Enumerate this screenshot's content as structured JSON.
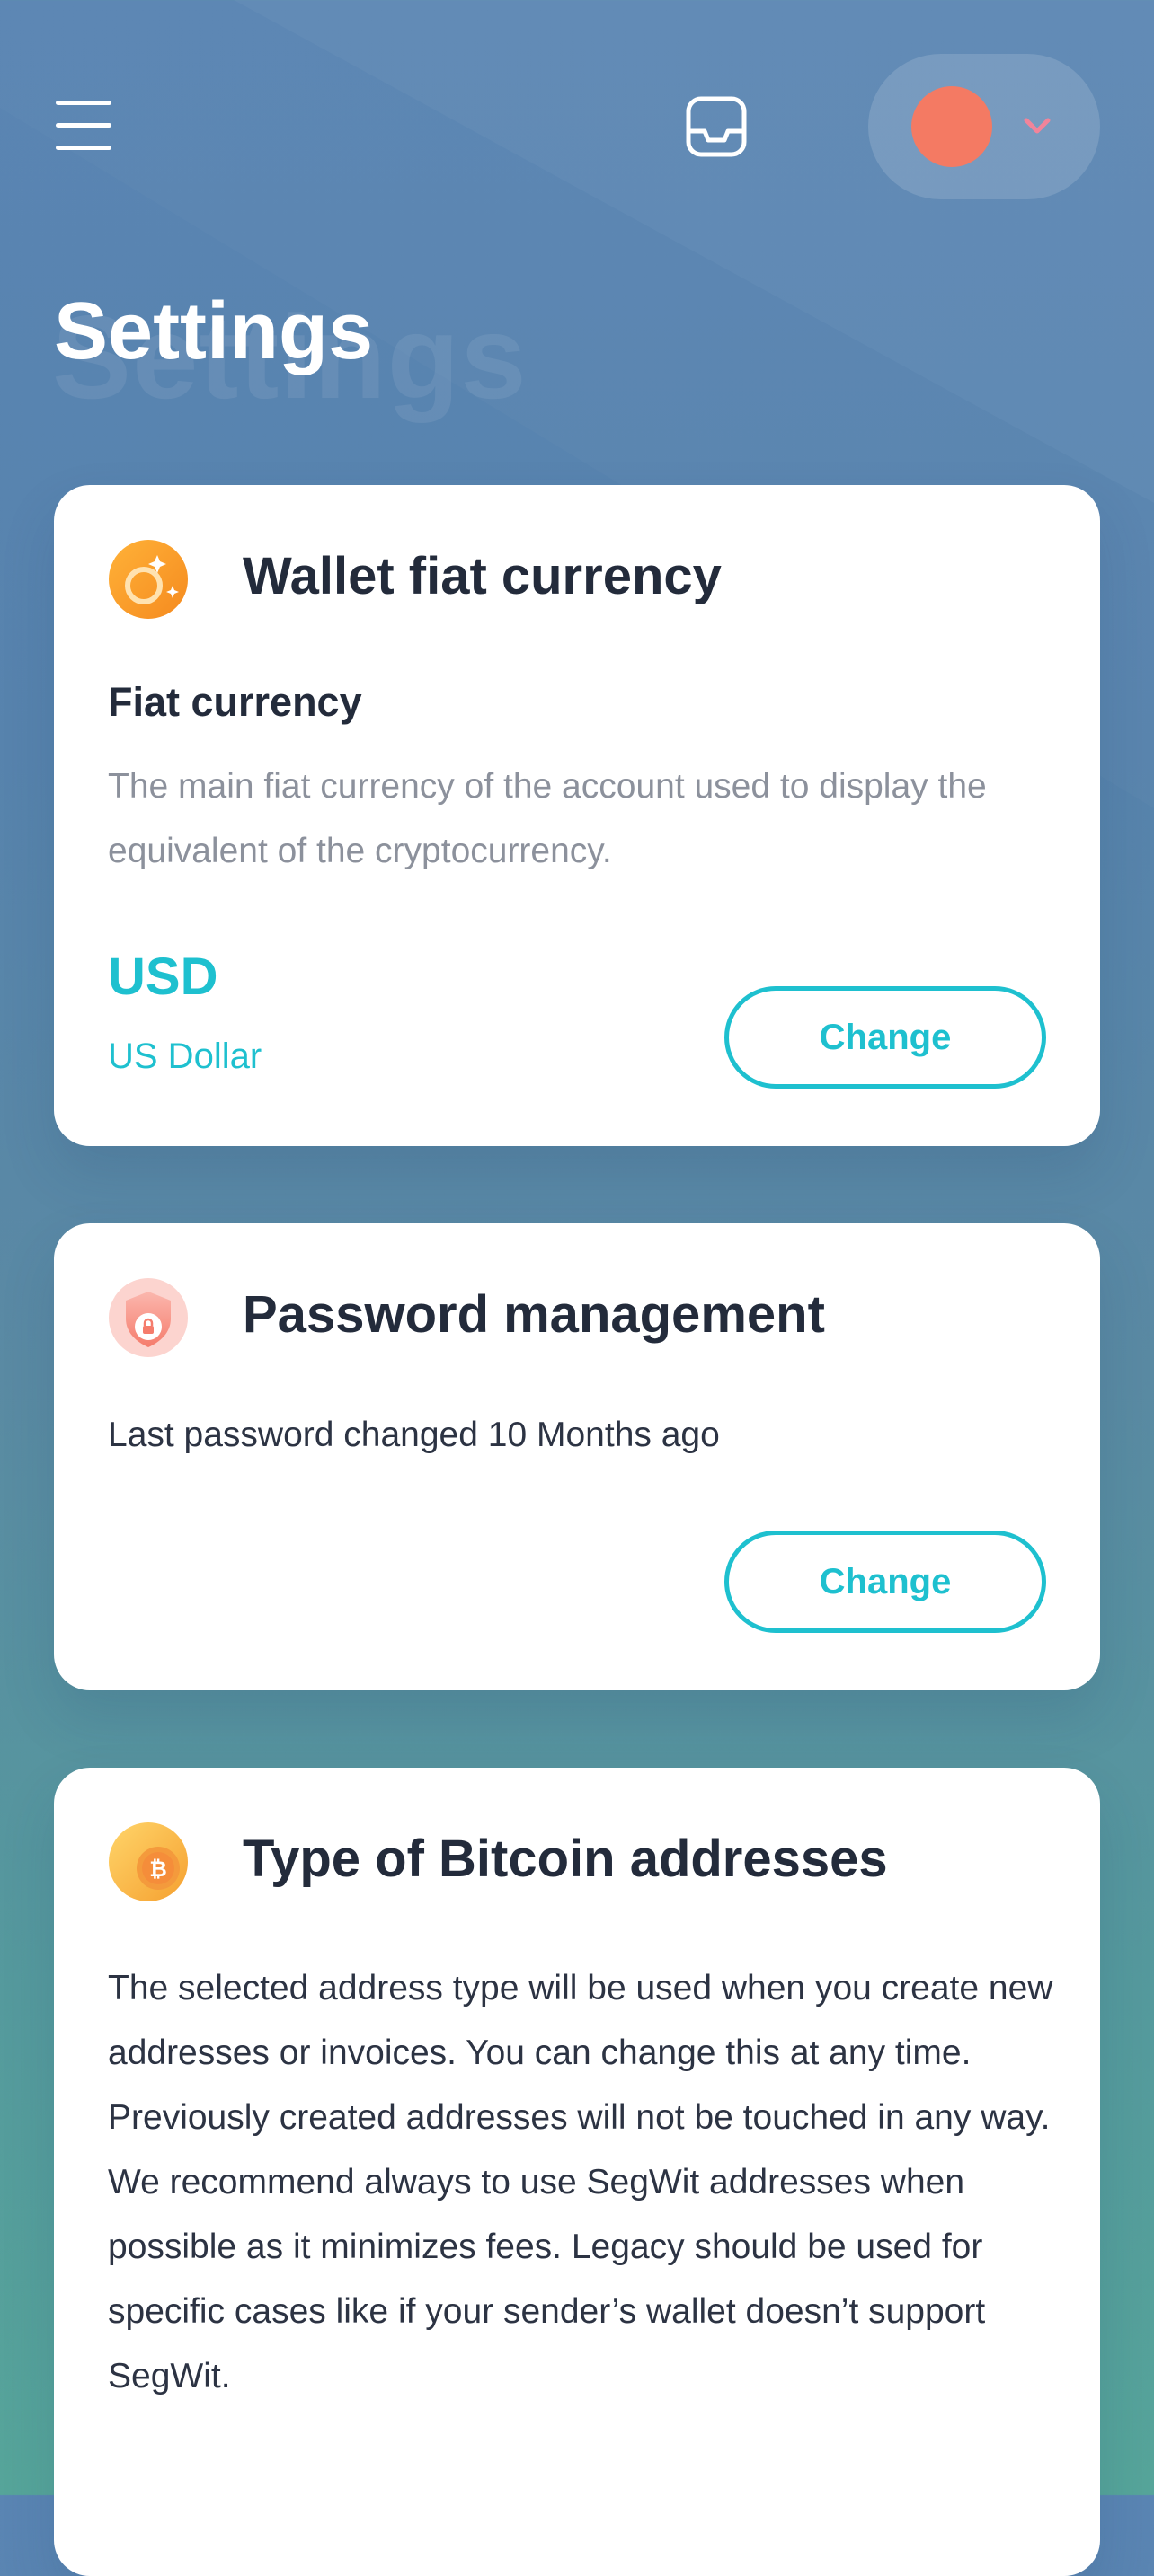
{
  "header": {
    "menu_icon": "hamburger-menu-icon",
    "inbox_icon": "inbox-tray-icon",
    "avatar_color": "#f47a63",
    "chevron_icon": "chevron-down-icon",
    "chevron_color": "#f2849a"
  },
  "page": {
    "title": "Settings",
    "title_ghost": "Settings"
  },
  "colors": {
    "accent": "#1ec0cf",
    "heading": "#232b3b",
    "muted": "#8c919c",
    "card_bg": "#ffffff"
  },
  "cards": {
    "fiat": {
      "icon": "currency-coin-icon",
      "title": "Wallet fiat currency",
      "subtitle": "Fiat currency",
      "description": "The main fiat currency of the account used to display the equivalent of the cryptocurrency.",
      "value_code": "USD",
      "value_name": "US Dollar",
      "button_label": "Change"
    },
    "password": {
      "icon": "shield-lock-icon",
      "title": "Password management",
      "status": "Last password changed 10 Months ago",
      "button_label": "Change"
    },
    "bitcoin": {
      "icon": "bitcoin-coin-icon",
      "title": "Type of Bitcoin addresses",
      "description": "The selected address type will be used when you create new addresses or invoices. You can change this at any time. Previously created addresses will not be touched in any way. We recommend always to use SegWit addresses when possible as it minimizes fees. Legacy should be used for specific cases like if your sender’s wallet doesn’t support SegWit."
    }
  }
}
